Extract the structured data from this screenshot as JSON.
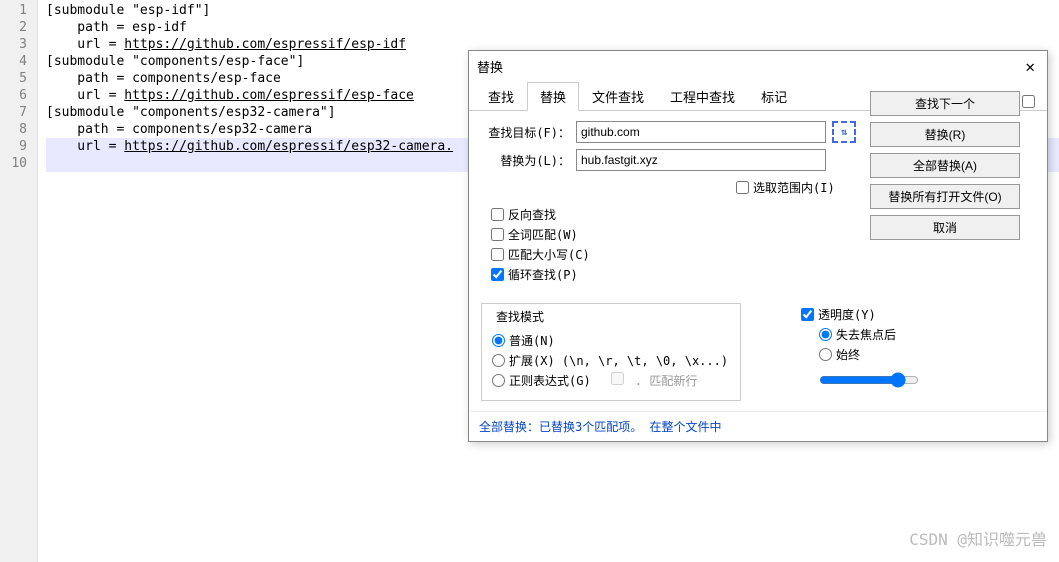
{
  "code": {
    "lines": [
      "[submodule \"esp-idf\"]",
      "    path = esp-idf",
      "    url = https://github.com/espressif/esp-idf",
      "[submodule \"components/esp-face\"]",
      "    path = components/esp-face",
      "    url = https://github.com/espressif/esp-face",
      "[submodule \"components/esp32-camera\"]",
      "    path = components/esp32-camera",
      "    url = https://github.com/espressif/esp32-camera."
    ],
    "url_line3": "https://github.com/espressif/esp-idf",
    "url_line6": "https://github.com/espressif/esp-face",
    "url_line9": "https://github.com/espressif/esp32-camera."
  },
  "dialog": {
    "title": "替换",
    "tabs": {
      "find": "查找",
      "replace": "替换",
      "findInFiles": "文件查找",
      "findInProjects": "工程中查找",
      "mark": "标记"
    },
    "labels": {
      "findWhat": "查找目标(F)：",
      "replaceWith": "替换为(L)："
    },
    "values": {
      "findWhat": "github.com",
      "replaceWith": "hub.fastgit.xyz"
    },
    "swap": "⇅",
    "checkboxes": {
      "inSelection": "选取范围内(I)",
      "backward": "反向查找",
      "wholeWord": "全词匹配(W)",
      "matchCase": "匹配大小写(C)",
      "wrap": "循环查找(P)"
    },
    "searchMode": {
      "title": "查找模式",
      "normal": "普通(N)",
      "extended": "扩展(X) (\\n, \\r, \\t, \\0, \\x...)",
      "regex": "正则表达式(G)",
      "dotNewline": ". 匹配新行"
    },
    "transparency": {
      "title": "透明度(Y)",
      "onLoseFocus": "失去焦点后",
      "always": "始终"
    },
    "buttons": {
      "findNext": "查找下一个",
      "replace": "替换(R)",
      "replaceAll": "全部替换(A)",
      "replaceAllOpen": "替换所有打开文件(O)",
      "cancel": "取消"
    },
    "status": "全部替换：已替换3个匹配项。 在整个文件中"
  },
  "watermark": "CSDN @知识噬元兽"
}
